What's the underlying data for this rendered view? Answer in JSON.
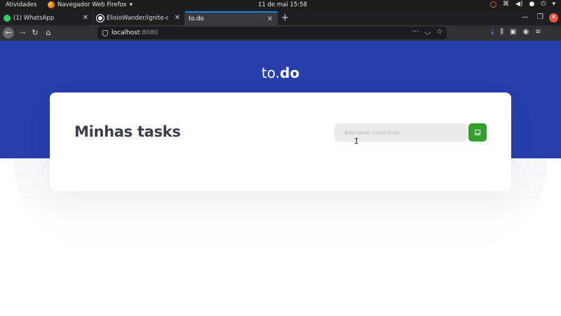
{
  "system": {
    "activities": "Atividades",
    "app_menu": "Navegador Web Firefox",
    "clock": "11 de mai  15:58"
  },
  "tabs": [
    {
      "label": "(1) WhatsApp",
      "icon": "whatsapp-icon",
      "color": "#25d366"
    },
    {
      "label": "ElisioWander/ignite-chal",
      "icon": "github-icon",
      "color": "#ffffff"
    },
    {
      "label": "to.do",
      "icon": "",
      "color": ""
    }
  ],
  "urlbar": {
    "host": "localhost",
    "port": ":8080"
  },
  "app": {
    "logo_prefix": "to.",
    "logo_bold": "do",
    "heading": "Minhas tasks",
    "new_task_placeholder": "Adicionar novo todo",
    "accent": "#273fad",
    "add_button_color": "#33a02c"
  }
}
